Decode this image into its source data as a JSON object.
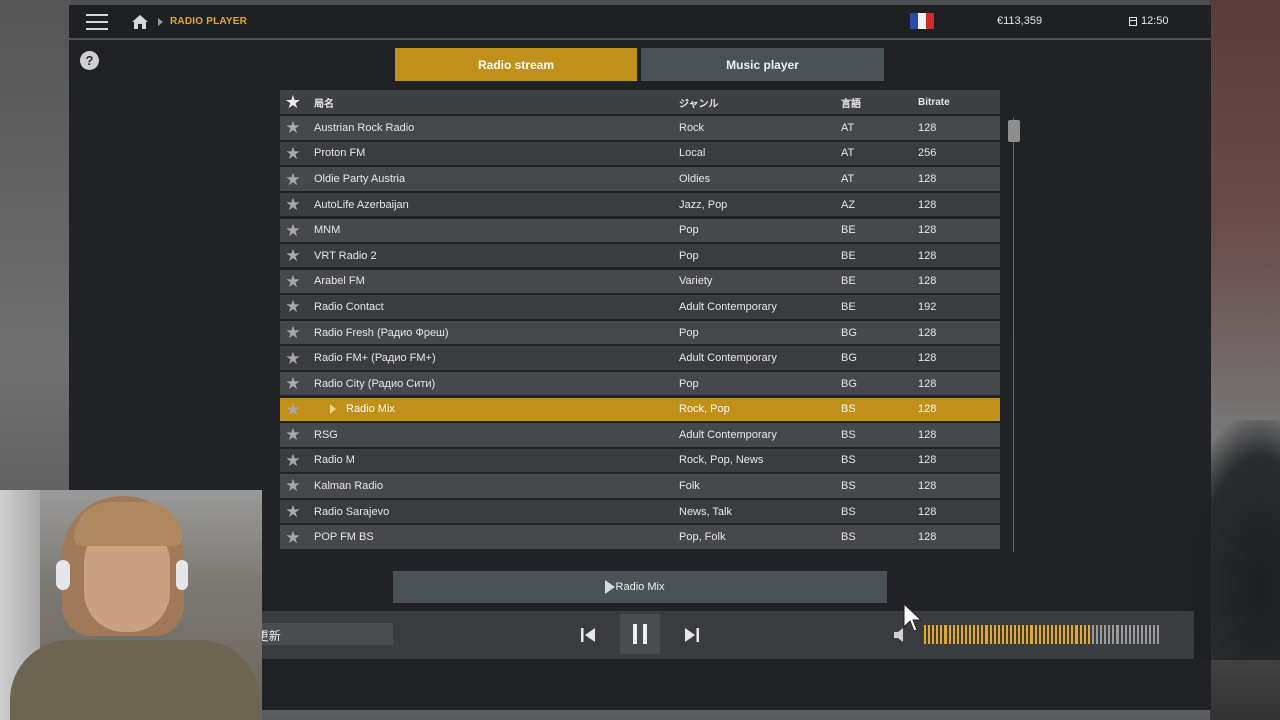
{
  "topbar": {
    "breadcrumb": "RADIO PLAYER",
    "money": "€113,359",
    "time": "12:50",
    "flag_colors": [
      "#2a4bb0",
      "#f2f2f2",
      "#d42a2a"
    ]
  },
  "help_label": "?",
  "tabs": [
    {
      "label": "Radio stream",
      "active": true
    },
    {
      "label": "Music player",
      "active": false
    }
  ],
  "table": {
    "columns": {
      "name": "局名",
      "genre": "ジャンル",
      "language": "言語",
      "bitrate": "Bitrate"
    },
    "rows": [
      {
        "name": "Austrian Rock Radio",
        "genre": "Rock",
        "lang": "AT",
        "bitrate": "128"
      },
      {
        "name": "Proton FM",
        "genre": "Local",
        "lang": "AT",
        "bitrate": "256"
      },
      {
        "name": "Oldie Party Austria",
        "genre": "Oldies",
        "lang": "AT",
        "bitrate": "128"
      },
      {
        "name": "AutoLife Azerbaijan",
        "genre": "Jazz, Pop",
        "lang": "AZ",
        "bitrate": "128"
      },
      {
        "name": "MNM",
        "genre": "Pop",
        "lang": "BE",
        "bitrate": "128"
      },
      {
        "name": "VRT Radio 2",
        "genre": "Pop",
        "lang": "BE",
        "bitrate": "128"
      },
      {
        "name": "Arabel FM",
        "genre": "Variety",
        "lang": "BE",
        "bitrate": "128"
      },
      {
        "name": "Radio Contact",
        "genre": "Adult Contemporary",
        "lang": "BE",
        "bitrate": "192"
      },
      {
        "name": "Radio Fresh (Радио Фреш)",
        "genre": "Pop",
        "lang": "BG",
        "bitrate": "128"
      },
      {
        "name": "Radio FM+ (Радио FM+)",
        "genre": "Adult Contemporary",
        "lang": "BG",
        "bitrate": "128"
      },
      {
        "name": "Radio City (Радио Сити)",
        "genre": "Pop",
        "lang": "BG",
        "bitrate": "128"
      },
      {
        "name": "Radio Mix",
        "genre": "Rock, Pop",
        "lang": "BS",
        "bitrate": "128"
      },
      {
        "name": "RSG",
        "genre": "Adult Contemporary",
        "lang": "BS",
        "bitrate": "128"
      },
      {
        "name": "Radio M",
        "genre": "Rock, Pop, News",
        "lang": "BS",
        "bitrate": "128"
      },
      {
        "name": "Kalman Radio",
        "genre": "Folk",
        "lang": "BS",
        "bitrate": "128"
      },
      {
        "name": "Radio Sarajevo",
        "genre": "News, Talk",
        "lang": "BS",
        "bitrate": "128"
      },
      {
        "name": "POP FM BS",
        "genre": "Pop, Folk",
        "lang": "BS",
        "bitrate": "128"
      }
    ],
    "selected_index": 11
  },
  "now_playing": "Radio Mix",
  "controls": {
    "refresh_label": "ラジオを更新",
    "volume_level": 0.7
  },
  "colors": {
    "accent": "#c1901a",
    "volume_on": "#e4a82a",
    "volume_off": "#9a9a9a"
  }
}
